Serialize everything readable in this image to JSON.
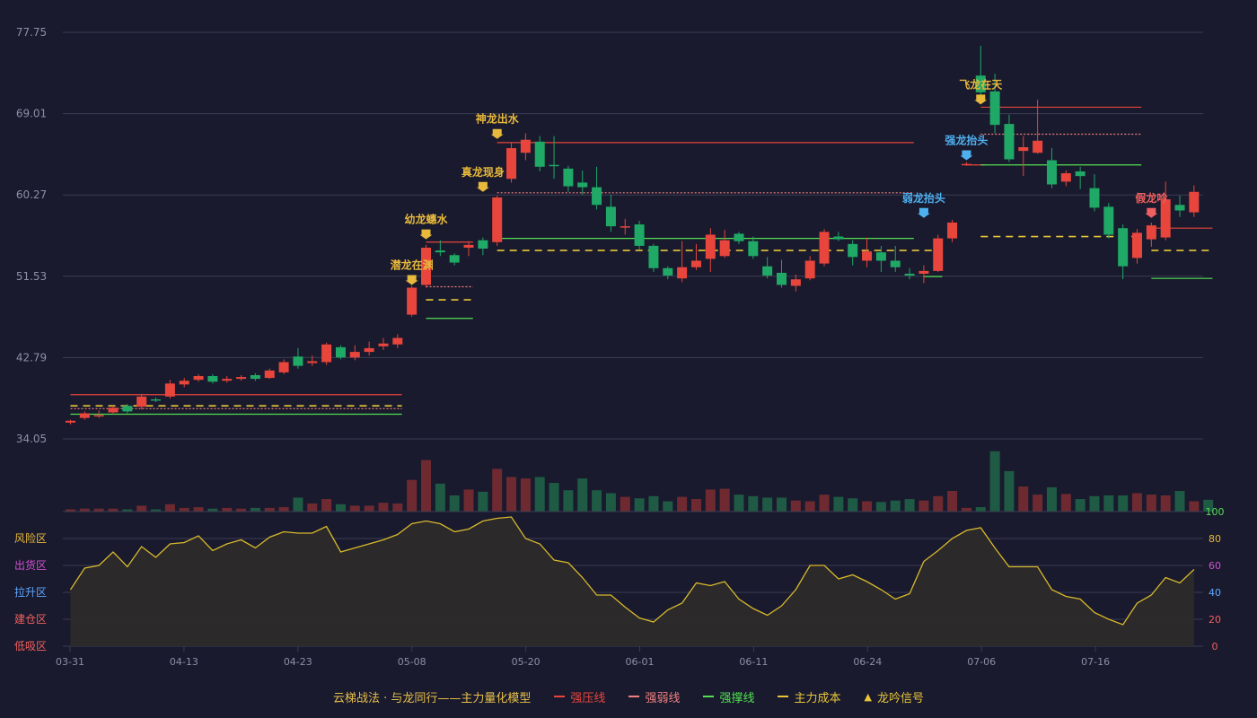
{
  "colors": {
    "background": "#191a2d",
    "up": "#e8453c",
    "down": "#1fa866",
    "grid": "#3a3c52",
    "axis_text": "#8d8fa6",
    "gold": "#e8b93c",
    "blue_signal": "#4fb0f0",
    "red_signal": "#f06060",
    "resistance": "#e8453c",
    "weak": "#f08080",
    "support": "#52e052",
    "cost": "#e8c63a",
    "osc_line": "#d8b92c",
    "osc_fill": "#2c2a2a"
  },
  "chart_data": {
    "type": "candlestick",
    "price_axis": {
      "ticks": [
        "77.75",
        "69.01",
        "60.27",
        "51.53",
        "42.79",
        "34.05"
      ]
    },
    "x_axis": {
      "ticks": [
        "03-31",
        "04-13",
        "04-23",
        "05-08",
        "05-20",
        "06-01",
        "06-11",
        "06-24",
        "07-06",
        "07-16"
      ]
    },
    "zone_labels": [
      "风险区",
      "出货区",
      "拉升区",
      "建仓区",
      "低吸区"
    ],
    "oscillator_axis": [
      "100",
      "80",
      "60",
      "40",
      "20",
      "0"
    ],
    "candles": [
      [
        35.8,
        36.0,
        35.6,
        36.1
      ],
      [
        36.3,
        36.8,
        36.1,
        37.0
      ],
      [
        36.5,
        36.6,
        36.3,
        37.1
      ],
      [
        36.9,
        37.4,
        36.7,
        37.6
      ],
      [
        37.6,
        37.0,
        36.8,
        37.8
      ],
      [
        37.5,
        38.6,
        37.2,
        38.9
      ],
      [
        38.3,
        38.2,
        38.0,
        38.5
      ],
      [
        38.6,
        40.0,
        38.4,
        40.4
      ],
      [
        39.9,
        40.3,
        39.6,
        40.6
      ],
      [
        40.4,
        40.8,
        40.2,
        41.0
      ],
      [
        40.8,
        40.2,
        40.0,
        41.0
      ],
      [
        40.3,
        40.5,
        40.1,
        40.8
      ],
      [
        40.5,
        40.7,
        40.3,
        40.9
      ],
      [
        40.9,
        40.5,
        40.3,
        41.1
      ],
      [
        40.6,
        41.4,
        40.5,
        41.6
      ],
      [
        41.2,
        42.3,
        41.0,
        42.6
      ],
      [
        42.9,
        41.9,
        41.6,
        43.8
      ],
      [
        42.2,
        42.4,
        41.9,
        43.0
      ],
      [
        42.3,
        44.2,
        42.0,
        44.4
      ],
      [
        43.9,
        42.8,
        42.6,
        44.1
      ],
      [
        42.8,
        43.4,
        42.5,
        44.1
      ],
      [
        43.4,
        43.8,
        43.0,
        44.5
      ],
      [
        44.0,
        44.3,
        43.6,
        44.9
      ],
      [
        44.2,
        44.9,
        43.8,
        45.3
      ],
      [
        47.4,
        50.3,
        47.2,
        50.5
      ],
      [
        50.6,
        54.6,
        50.3,
        54.9
      ],
      [
        54.3,
        54.1,
        53.7,
        55.4
      ],
      [
        53.8,
        53.0,
        52.7,
        54.0
      ],
      [
        54.6,
        54.9,
        53.7,
        55.3
      ],
      [
        55.4,
        54.5,
        53.8,
        55.7
      ],
      [
        55.2,
        60.0,
        54.8,
        60.2
      ],
      [
        62.0,
        65.3,
        61.6,
        65.9
      ],
      [
        64.8,
        66.2,
        64.0,
        66.9
      ],
      [
        66.0,
        63.3,
        62.8,
        66.6
      ],
      [
        63.5,
        63.4,
        62.0,
        66.6
      ],
      [
        63.1,
        61.2,
        60.6,
        63.4
      ],
      [
        61.6,
        61.1,
        60.3,
        62.9
      ],
      [
        61.1,
        59.2,
        58.7,
        63.3
      ],
      [
        59.0,
        56.9,
        56.3,
        60.3
      ],
      [
        56.8,
        56.9,
        56.0,
        57.7
      ],
      [
        57.1,
        54.8,
        54.4,
        57.5
      ],
      [
        54.8,
        52.4,
        52.0,
        55.0
      ],
      [
        52.4,
        51.6,
        51.2,
        52.6
      ],
      [
        51.3,
        52.5,
        50.9,
        55.3
      ],
      [
        52.5,
        53.2,
        52.2,
        55.0
      ],
      [
        53.4,
        56.0,
        52.0,
        56.7
      ],
      [
        53.7,
        55.4,
        53.5,
        56.5
      ],
      [
        56.1,
        55.3,
        55.0,
        56.3
      ],
      [
        55.3,
        53.7,
        53.4,
        55.8
      ],
      [
        52.6,
        51.6,
        51.3,
        53.6
      ],
      [
        51.9,
        50.6,
        50.3,
        53.3
      ],
      [
        50.5,
        51.2,
        49.9,
        51.7
      ],
      [
        51.3,
        53.2,
        51.1,
        53.7
      ],
      [
        52.9,
        56.3,
        52.6,
        56.6
      ],
      [
        55.8,
        55.5,
        55.3,
        56.3
      ],
      [
        55.0,
        53.6,
        52.7,
        55.4
      ],
      [
        53.2,
        54.2,
        52.5,
        55.7
      ],
      [
        54.1,
        53.2,
        52.0,
        54.8
      ],
      [
        53.2,
        52.5,
        52.0,
        54.8
      ],
      [
        51.8,
        51.6,
        51.2,
        52.4
      ],
      [
        51.8,
        52.1,
        50.8,
        52.7
      ],
      [
        52.1,
        55.6,
        52.0,
        56.0
      ],
      [
        55.6,
        57.3,
        55.2,
        57.6
      ],
      [
        63.6,
        63.6,
        63.4,
        63.8
      ],
      [
        73.1,
        71.3,
        70.5,
        76.3
      ],
      [
        71.4,
        67.8,
        66.9,
        73.3
      ],
      [
        67.9,
        64.1,
        63.8,
        68.9
      ],
      [
        65.0,
        65.4,
        62.3,
        66.6
      ],
      [
        64.8,
        66.1,
        64.7,
        70.5
      ],
      [
        64.0,
        61.4,
        61.0,
        65.3
      ],
      [
        61.7,
        62.6,
        61.2,
        62.9
      ],
      [
        62.8,
        62.3,
        60.9,
        63.3
      ],
      [
        61.0,
        58.9,
        58.5,
        62.5
      ],
      [
        59.0,
        56.0,
        55.6,
        59.4
      ],
      [
        56.7,
        52.6,
        51.2,
        57.1
      ],
      [
        53.5,
        56.2,
        52.9,
        56.6
      ],
      [
        55.5,
        57.0,
        54.7,
        57.3
      ],
      [
        55.7,
        59.8,
        55.4,
        61.7
      ],
      [
        59.2,
        58.6,
        57.9,
        60.2
      ],
      [
        58.4,
        60.6,
        57.9,
        61.3
      ]
    ],
    "volume_pct": [
      3,
      4,
      4,
      4,
      3,
      8,
      3,
      10,
      5,
      6,
      4,
      5,
      4,
      5,
      5,
      6,
      19,
      11,
      17,
      10,
      8,
      8,
      12,
      11,
      43,
      70,
      38,
      22,
      30,
      27,
      58,
      47,
      45,
      47,
      39,
      29,
      45,
      29,
      25,
      20,
      18,
      21,
      14,
      20,
      17,
      30,
      31,
      23,
      21,
      19,
      19,
      15,
      14,
      23,
      20,
      18,
      14,
      13,
      15,
      17,
      15,
      21,
      28,
      5,
      6,
      82,
      55,
      34,
      23,
      33,
      24,
      17,
      21,
      22,
      22,
      25,
      23,
      22,
      28,
      14,
      16
    ],
    "oscillator": [
      42,
      58,
      60,
      70,
      59,
      74,
      66,
      76,
      77,
      82,
      71,
      76,
      79,
      73,
      81,
      85,
      84,
      84,
      89,
      70,
      73,
      76,
      79,
      83,
      91,
      93,
      91,
      85,
      87,
      93,
      95,
      96,
      80,
      76,
      64,
      62,
      51,
      38,
      38,
      29,
      21,
      18,
      27,
      32,
      47,
      45,
      48,
      35,
      28,
      23,
      30,
      42,
      60,
      60,
      50,
      53,
      48,
      42,
      35,
      39,
      63,
      71,
      80,
      86,
      88,
      73,
      59,
      59,
      59,
      42,
      37,
      35,
      25,
      20,
      16,
      32,
      38,
      51,
      47,
      57
    ]
  },
  "levels": [
    {
      "type": "resistance",
      "from": 0,
      "to": 23,
      "price": 38.8
    },
    {
      "type": "cost",
      "from": 0,
      "to": 23,
      "price": 37.6
    },
    {
      "type": "weak",
      "from": 0,
      "to": 23,
      "price": 37.3
    },
    {
      "type": "support",
      "from": 0,
      "to": 23,
      "price": 36.7
    },
    {
      "type": "resistance",
      "from": 25,
      "to": 28,
      "price": 55.2
    },
    {
      "type": "weak",
      "from": 25,
      "to": 28,
      "price": 50.4
    },
    {
      "type": "cost",
      "from": 25,
      "to": 28,
      "price": 49.0
    },
    {
      "type": "support",
      "from": 25,
      "to": 28,
      "price": 47.0
    },
    {
      "type": "resistance",
      "from": 30,
      "to": 59,
      "price": 65.9
    },
    {
      "type": "weak",
      "from": 30,
      "to": 59,
      "price": 60.5
    },
    {
      "type": "support",
      "from": 30,
      "to": 59,
      "price": 55.6
    },
    {
      "type": "cost",
      "from": 30,
      "to": 61,
      "price": 54.3
    },
    {
      "type": "support",
      "from": 60,
      "to": 61,
      "price": 51.5
    },
    {
      "type": "resistance",
      "from": 63,
      "to": 64,
      "price": 63.5
    },
    {
      "type": "resistance",
      "from": 64,
      "to": 75,
      "price": 69.7
    },
    {
      "type": "weak",
      "from": 64,
      "to": 75,
      "price": 66.8
    },
    {
      "type": "support",
      "from": 64,
      "to": 75,
      "price": 63.5
    },
    {
      "type": "cost",
      "from": 64,
      "to": 75,
      "price": 55.8
    },
    {
      "type": "resistance",
      "from": 76,
      "to": 80,
      "price": 56.7
    },
    {
      "type": "cost",
      "from": 76,
      "to": 80,
      "price": 54.3
    },
    {
      "type": "support",
      "from": 76,
      "to": 80,
      "price": 51.3
    }
  ],
  "signals": [
    {
      "label": "潜龙在渊",
      "index": 24,
      "price": 50.6,
      "color": "gold"
    },
    {
      "label": "幼龙蟪水",
      "index": 25,
      "price": 55.5,
      "color": "gold"
    },
    {
      "label": "真龙现身",
      "index": 29,
      "price": 60.6,
      "color": "gold"
    },
    {
      "label": "神龙出水",
      "index": 30,
      "price": 66.3,
      "color": "gold"
    },
    {
      "label": "弱龙抬头",
      "index": 60,
      "price": 57.8,
      "color": "blue_signal"
    },
    {
      "label": "强龙抬头",
      "index": 63,
      "price": 64.0,
      "color": "blue_signal"
    },
    {
      "label": "飞龙在天",
      "index": 64,
      "price": 70.0,
      "color": "gold"
    },
    {
      "label": "假龙吟",
      "index": 76,
      "price": 57.8,
      "color": "red_signal"
    }
  ],
  "legend": {
    "title": "云梯战法 · 与龙同行——主力量化模型",
    "items": [
      {
        "label": "强压线",
        "color": "#e8453c",
        "dashed": false
      },
      {
        "label": "强弱线",
        "color": "#f08080",
        "dashed": true
      },
      {
        "label": "强撑线",
        "color": "#52e052",
        "dashed": false
      },
      {
        "label": "主力成本",
        "color": "#e8c63a",
        "dashed": true
      }
    ],
    "signal_item": {
      "glyph": "▲",
      "label": "龙吟信号"
    }
  }
}
